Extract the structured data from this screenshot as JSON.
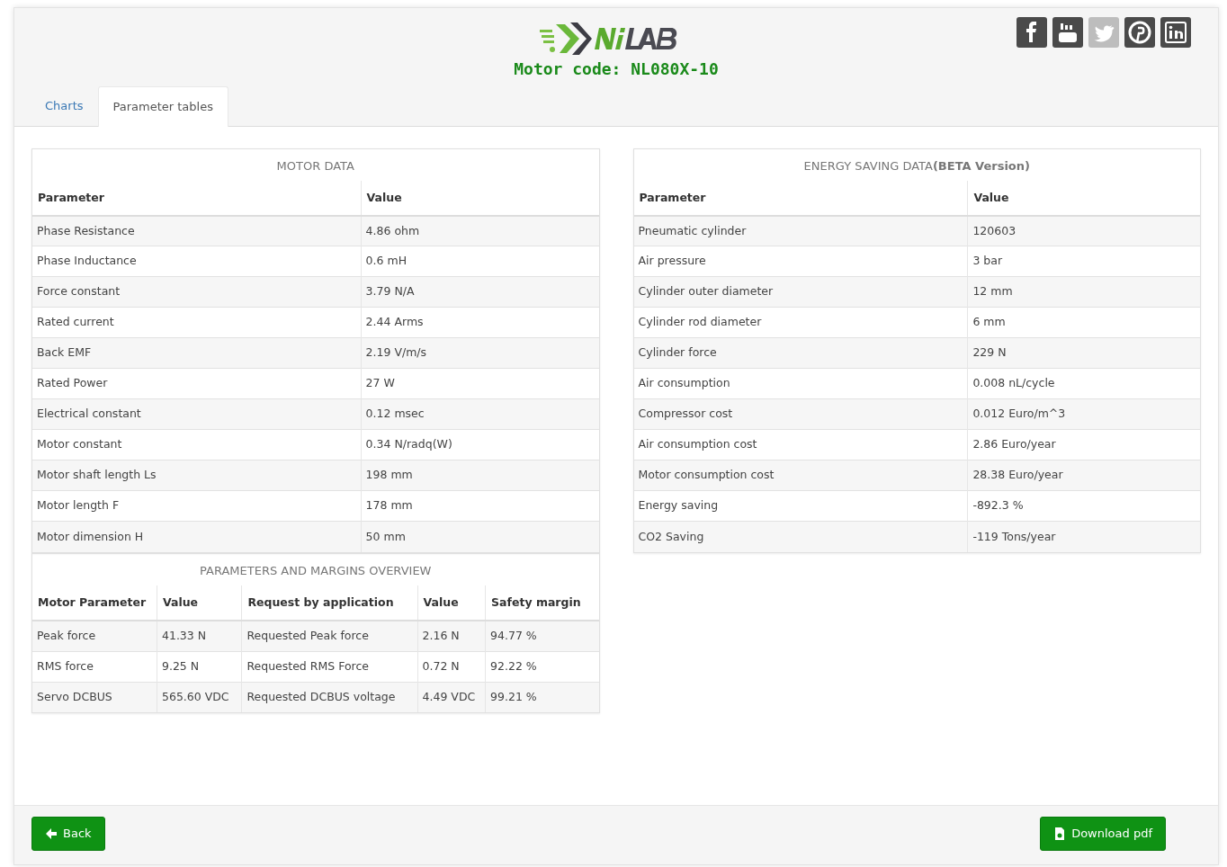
{
  "header": {
    "motor_code": "Motor code: NL080X-10"
  },
  "social": [
    {
      "kind": "facebook",
      "disabled": false
    },
    {
      "kind": "youtube",
      "disabled": false
    },
    {
      "kind": "twitter",
      "disabled": true
    },
    {
      "kind": "pinterest",
      "disabled": false
    },
    {
      "kind": "linkedin",
      "disabled": false
    }
  ],
  "tabs": [
    {
      "label": "Charts",
      "selected": false
    },
    {
      "label": "Parameter tables",
      "selected": true
    }
  ],
  "motor_data": {
    "title": "MOTOR DATA",
    "columns": [
      "Parameter",
      "Value"
    ],
    "rows": [
      [
        "Phase Resistance",
        "4.86 ohm"
      ],
      [
        "Phase Inductance",
        "0.6 mH"
      ],
      [
        "Force constant",
        "3.79 N/A"
      ],
      [
        "Rated current",
        "2.44 Arms"
      ],
      [
        "Back EMF",
        "2.19 V/m/s"
      ],
      [
        "Rated Power",
        "27 W"
      ],
      [
        "Electrical constant",
        "0.12 msec"
      ],
      [
        "Motor constant",
        "0.34 N/radq(W)"
      ],
      [
        "Motor shaft length Ls",
        "198 mm"
      ],
      [
        "Motor length F",
        "178 mm"
      ],
      [
        "Motor dimension H",
        "50 mm"
      ]
    ]
  },
  "margins": {
    "title": "PARAMETERS AND MARGINS OVERVIEW",
    "columns": [
      "Motor Parameter",
      "Value",
      "Request by application",
      "Value",
      "Safety margin"
    ],
    "rows": [
      [
        "Peak force",
        "41.33 N",
        "Requested Peak force",
        "2.16 N",
        "94.77 %"
      ],
      [
        "RMS force",
        "9.25 N",
        "Requested RMS Force",
        "0.72 N",
        "92.22 %"
      ],
      [
        "Servo DCBUS",
        "565.60 VDC",
        "Requested DCBUS voltage",
        "4.49 VDC",
        "99.21 %"
      ]
    ]
  },
  "energy_data": {
    "title": "ENERGY SAVING DATA**(BETA Version)**",
    "columns": [
      "Parameter",
      "Value"
    ],
    "rows": [
      [
        "Pneumatic cylinder",
        "120603"
      ],
      [
        "Air pressure",
        "3 bar"
      ],
      [
        "Cylinder outer diameter",
        "12 mm"
      ],
      [
        "Cylinder rod diameter",
        "6 mm"
      ],
      [
        "Cylinder force",
        "229 N"
      ],
      [
        "Air consumption",
        "0.008 nL/cycle"
      ],
      [
        "Compressor cost",
        "0.012 Euro/m^3"
      ],
      [
        "Air consumption cost",
        "2.86 Euro/year"
      ],
      [
        "Motor consumption cost",
        "28.38 Euro/year"
      ],
      [
        "Energy saving",
        "-892.3 %"
      ],
      [
        "CO2 Saving",
        "-119 Tons/year"
      ]
    ]
  },
  "footer": {
    "back_button": "Back",
    "download_button": "Download pdf"
  }
}
